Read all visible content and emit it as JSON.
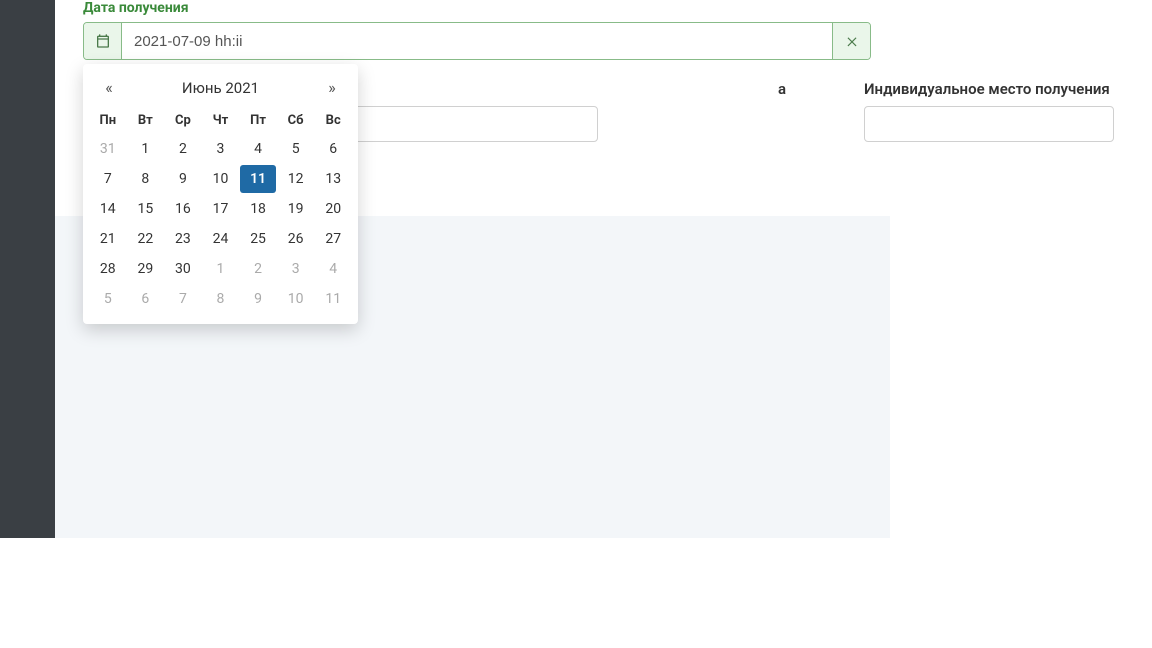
{
  "labels": {
    "date_received": "Дата получения",
    "left_col": "a",
    "right_col": "Индивидуальное место получения"
  },
  "date_input": {
    "value": "2021-07-09 hh:ii"
  },
  "calendar": {
    "month_title": "Июнь 2021",
    "prev_glyph": "«",
    "next_glyph": "»",
    "dow": [
      "Пн",
      "Вт",
      "Ср",
      "Чт",
      "Пт",
      "Сб",
      "Вс"
    ],
    "weeks": [
      [
        {
          "d": "31",
          "m": true
        },
        {
          "d": "1"
        },
        {
          "d": "2"
        },
        {
          "d": "3"
        },
        {
          "d": "4"
        },
        {
          "d": "5"
        },
        {
          "d": "6"
        }
      ],
      [
        {
          "d": "7"
        },
        {
          "d": "8"
        },
        {
          "d": "9"
        },
        {
          "d": "10"
        },
        {
          "d": "11",
          "sel": true
        },
        {
          "d": "12"
        },
        {
          "d": "13"
        }
      ],
      [
        {
          "d": "14"
        },
        {
          "d": "15"
        },
        {
          "d": "16"
        },
        {
          "d": "17"
        },
        {
          "d": "18"
        },
        {
          "d": "19"
        },
        {
          "d": "20"
        }
      ],
      [
        {
          "d": "21"
        },
        {
          "d": "22"
        },
        {
          "d": "23"
        },
        {
          "d": "24"
        },
        {
          "d": "25"
        },
        {
          "d": "26"
        },
        {
          "d": "27"
        }
      ],
      [
        {
          "d": "28"
        },
        {
          "d": "29"
        },
        {
          "d": "30"
        },
        {
          "d": "1",
          "m": true
        },
        {
          "d": "2",
          "m": true
        },
        {
          "d": "3",
          "m": true
        },
        {
          "d": "4",
          "m": true
        }
      ],
      [
        {
          "d": "5",
          "m": true
        },
        {
          "d": "6",
          "m": true
        },
        {
          "d": "7",
          "m": true
        },
        {
          "d": "8",
          "m": true
        },
        {
          "d": "9",
          "m": true
        },
        {
          "d": "10",
          "m": true
        },
        {
          "d": "11",
          "m": true
        }
      ]
    ]
  }
}
